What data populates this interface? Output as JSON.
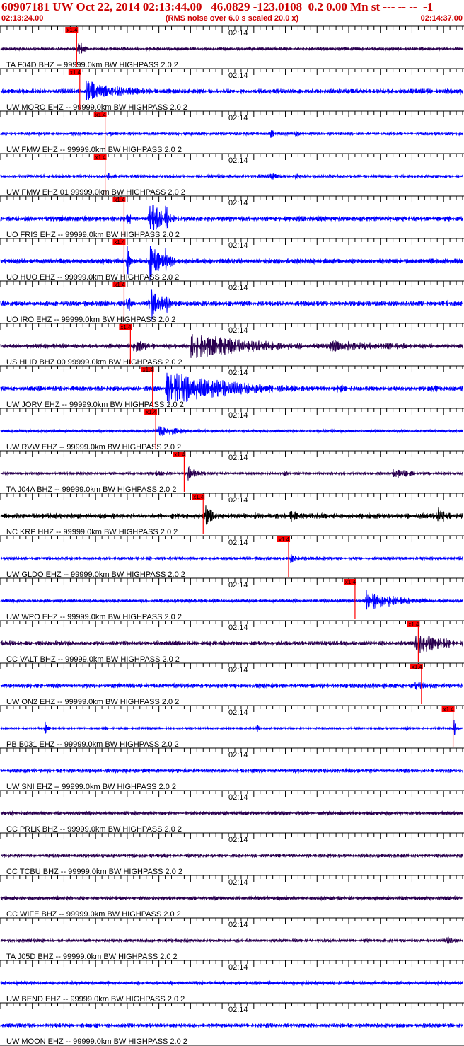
{
  "header": {
    "title": "60907181 UW Oct 22, 2014 02:13:44.00   46.0829 -123.0108  0.2 0.00 Mn st --- -- --  -1",
    "start_time": "02:13:24.00",
    "note": "(RMS noise over 6.0 s scaled 20.0 x)",
    "end_time": "02:14:37.00"
  },
  "chart_data": {
    "type": "line",
    "title": "60907181 UW Oct 22, 2014 02:13:44.00   46.0829 -123.0108  0.2 0.00 Mn st --- -- --  -1",
    "x_start": "02:13:24.00",
    "x_end": "02:14:37.00",
    "x_range_seconds": [
      0,
      73
    ],
    "time_tick_label": "02:14",
    "time_tick_seconds": 36,
    "pick_label": "x1.4",
    "colors": {
      "blue": "#0000ff",
      "dark": "#2a0050",
      "black": "#000000",
      "pick": "#ff0000"
    },
    "series": [
      {
        "name": "TA F04D BHZ -- 99999.0km BW  HIGHPASS  2.0  2",
        "color": "dark",
        "noise": 0.12,
        "pick_s": 12.0,
        "events": [
          [
            12.2,
            0.9,
            0.8
          ]
        ]
      },
      {
        "name": "UW MORO EHZ -- 99999.0km BW  HIGHPASS  2.0  2",
        "color": "blue",
        "noise": 0.2,
        "pick_s": 12.5,
        "events": [
          [
            13.5,
            0.9,
            5.0
          ],
          [
            18.0,
            0.45,
            8.0
          ]
        ]
      },
      {
        "name": "UW FMW EHZ -- 99999.0km BW  HIGHPASS  2.0  2",
        "color": "blue",
        "noise": 0.12,
        "pick_s": 16.5,
        "events": [
          [
            16.8,
            0.45,
            1.0
          ],
          [
            42.5,
            0.4,
            1.5
          ],
          [
            46.5,
            0.3,
            1.0
          ]
        ]
      },
      {
        "name": "UW FMW EHZ 01 99999.0km BW  HIGHPASS  2.0  2",
        "color": "blue",
        "noise": 0.12,
        "pick_s": 16.5,
        "events": [
          [
            16.8,
            0.45,
            1.0
          ],
          [
            42.5,
            0.4,
            1.5
          ],
          [
            46.5,
            0.3,
            1.0
          ]
        ]
      },
      {
        "name": "UO FRIS EHZ -- 99999.0km BW  HIGHPASS  2.0  2",
        "color": "blue",
        "noise": 0.2,
        "pick_s": 19.5,
        "events": [
          [
            20.0,
            1.4,
            0.4
          ],
          [
            23.5,
            1.6,
            2.0
          ],
          [
            26.0,
            1.2,
            1.0
          ]
        ]
      },
      {
        "name": "UO HUO EHZ -- 99999.0km BW  HIGHPASS  2.0  2",
        "color": "blue",
        "noise": 0.2,
        "pick_s": 19.5,
        "events": [
          [
            20.0,
            1.4,
            0.4
          ],
          [
            23.5,
            1.6,
            2.0
          ],
          [
            26.0,
            1.2,
            1.0
          ]
        ]
      },
      {
        "name": "UO IRO EHZ -- 99999.0km BW  HIGHPASS  2.0  2",
        "color": "blue",
        "noise": 0.2,
        "pick_s": 19.5,
        "events": [
          [
            20.0,
            1.4,
            0.4
          ],
          [
            23.5,
            1.6,
            2.0
          ],
          [
            26.0,
            1.2,
            1.0
          ]
        ]
      },
      {
        "name": "US HLID BHZ 00 99999.0km BW  HIGHPASS  2.0  2",
        "color": "dark",
        "noise": 0.18,
        "pick_s": 20.5,
        "events": [
          [
            21.0,
            0.6,
            3.0
          ],
          [
            30.0,
            1.1,
            12.0
          ],
          [
            52.0,
            0.5,
            14.0
          ]
        ]
      },
      {
        "name": "UW JORV EHZ -- 99999.0km BW  HIGHPASS  2.0  2",
        "color": "blue",
        "noise": 0.18,
        "pick_s": 24.0,
        "events": [
          [
            26.0,
            1.4,
            12.0
          ],
          [
            53.0,
            0.45,
            2.0
          ],
          [
            68.0,
            0.4,
            3.0
          ]
        ]
      },
      {
        "name": "UW RVW EHZ -- 99999.0km BW  HIGHPASS  2.0  2",
        "color": "blue",
        "noise": 0.12,
        "pick_s": 24.5,
        "events": [
          [
            24.8,
            0.5,
            4.0
          ]
        ]
      },
      {
        "name": "TA J04A BHZ -- 99999.0km BW  HIGHPASS  2.0  2",
        "color": "dark",
        "noise": 0.1,
        "pick_s": 29.0,
        "events": [
          [
            24.5,
            0.3,
            2.0
          ],
          [
            29.5,
            0.6,
            2.0
          ],
          [
            44.5,
            0.3,
            1.0
          ],
          [
            62.0,
            0.45,
            4.0
          ]
        ]
      },
      {
        "name": "NC KRP HHZ -- 99999.0km BW  HIGHPASS  2.0  2",
        "color": "black",
        "noise": 0.22,
        "pick_s": 32.0,
        "events": [
          [
            32.2,
            1.0,
            1.5
          ],
          [
            45.5,
            0.8,
            2.0
          ],
          [
            69.0,
            0.9,
            1.5
          ]
        ]
      },
      {
        "name": "UW GLDO EHZ -- 99999.0km BW  HIGHPASS  2.0  2",
        "color": "blue",
        "noise": 0.12,
        "pick_s": 45.5,
        "events": [
          [
            45.8,
            0.35,
            1.5
          ]
        ]
      },
      {
        "name": "UW WPO EHZ -- 99999.0km BW  HIGHPASS  2.0  2",
        "color": "blue",
        "noise": 0.12,
        "pick_s": 56.0,
        "events": [
          [
            57.5,
            1.0,
            5.0
          ]
        ]
      },
      {
        "name": "CC VALT BHZ -- 99999.0km BW  HIGHPASS  2.0  2",
        "color": "dark",
        "noise": 0.18,
        "pick_s": 66.0,
        "events": [
          [
            65.5,
            0.9,
            6.0
          ]
        ]
      },
      {
        "name": "UW ON2 EHZ -- 99999.0km BW  HIGHPASS  2.0  2",
        "color": "blue",
        "noise": 0.18,
        "pick_s": 66.5,
        "events": [
          [
            65.5,
            0.35,
            3.0
          ]
        ]
      },
      {
        "name": "PB B031 EHZ -- 99999.0km BW  HIGHPASS  2.0  2",
        "color": "blue",
        "noise": 0.08,
        "pick_s": 71.5,
        "events": [
          [
            7.0,
            0.8,
            0.4
          ],
          [
            16.5,
            0.4,
            0.3
          ],
          [
            40.5,
            0.4,
            0.3
          ],
          [
            64.0,
            0.4,
            0.4
          ],
          [
            71.5,
            1.0,
            0.5
          ]
        ]
      },
      {
        "name": "UW SNI EHZ -- 99999.0km BW  HIGHPASS  2.0  2",
        "color": "blue",
        "noise": 0.16,
        "pick_s": null,
        "events": []
      },
      {
        "name": "CC PRLK BHZ -- 99999.0km BW  HIGHPASS  2.0  2",
        "color": "dark",
        "noise": 0.14,
        "pick_s": null,
        "events": []
      },
      {
        "name": "CC TCBU BHZ -- 99999.0km BW  HIGHPASS  2.0  2",
        "color": "dark",
        "noise": 0.14,
        "pick_s": null,
        "events": []
      },
      {
        "name": "CC WIFE BHZ -- 99999.0km BW  HIGHPASS  2.0  2",
        "color": "dark",
        "noise": 0.14,
        "pick_s": null,
        "events": []
      },
      {
        "name": "TA J05D BHZ -- 99999.0km BW  HIGHPASS  2.0  2",
        "color": "dark",
        "noise": 0.12,
        "pick_s": null,
        "events": [
          [
            70.5,
            0.35,
            2.0
          ]
        ]
      },
      {
        "name": "UW BEND EHZ -- 99999.0km BW  HIGHPASS  2.0  2",
        "color": "blue",
        "noise": 0.16,
        "pick_s": null,
        "events": []
      },
      {
        "name": "UW MOON EHZ -- 99999.0km BW  HIGHPASS  2.0  2",
        "color": "blue",
        "noise": 0.16,
        "pick_s": null,
        "events": []
      }
    ]
  }
}
